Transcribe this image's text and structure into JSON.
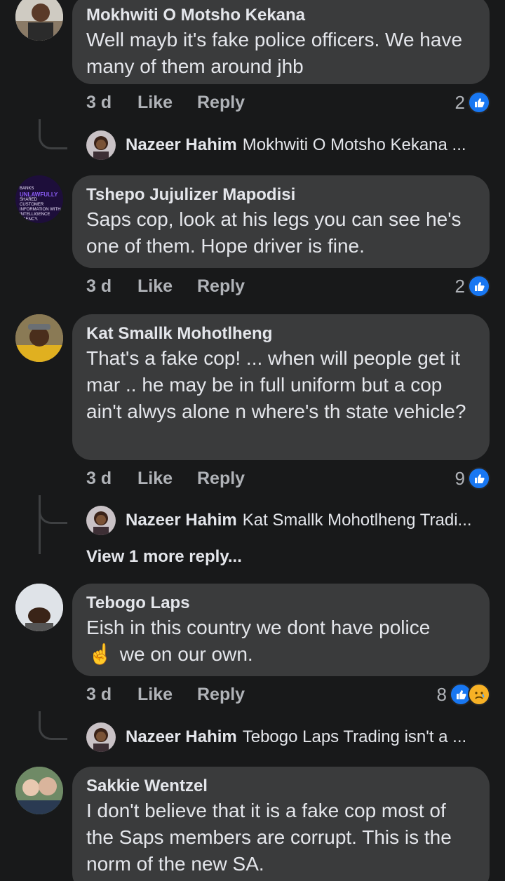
{
  "comments": [
    {
      "author": "Mokhwiti O Motsho Kekana",
      "text": "Well mayb it's fake police officers. We have many of them around jhb",
      "time": "3 d",
      "like_label": "Like",
      "reply_label": "Reply",
      "reaction_count": "2",
      "reply": {
        "author": "Nazeer Hahim",
        "preview": "Mokhwiti O Motsho Kekana ..."
      }
    },
    {
      "author": "Tshepo Jujulizer Mapodisi",
      "text": "Saps cop, look at his legs you can see he's one of them. Hope driver is fine.",
      "time": "3 d",
      "like_label": "Like",
      "reply_label": "Reply",
      "reaction_count": "2",
      "avatar_text": [
        "BANKS",
        "UNLAWFULLY",
        "SHARED CUSTOMER",
        "INFORMATION WITH",
        "INTELLIGENCE",
        "AGENCY."
      ]
    },
    {
      "author": "Kat Smallk Mohotlheng",
      "text": "That's a fake cop! ... when will people get it mar .. he may be in full uniform but a cop ain't alwys alone n where's th state vehicle?",
      "time": "3 d",
      "like_label": "Like",
      "reply_label": "Reply",
      "reaction_count": "9",
      "reply": {
        "author": "Nazeer Hahim",
        "preview": "Kat Smallk Mohotlheng Tradi..."
      },
      "view_more": "View 1 more reply..."
    },
    {
      "author": "Tebogo Laps",
      "text_line1": "Eish in this country we dont have police",
      "emoji": "☝",
      "text_line2": "we on our own.",
      "time": "3 d",
      "like_label": "Like",
      "reply_label": "Reply",
      "reaction_count": "8",
      "reply": {
        "author": "Nazeer Hahim",
        "preview": "Tebogo Laps Trading isn't a ..."
      }
    },
    {
      "author": "Sakkie Wentzel",
      "text": "I don't believe that it is a fake cop most of the Saps members are corrupt. This is the norm of the new SA."
    }
  ],
  "colors": {
    "background": "#18191a",
    "bubble": "#3a3b3c",
    "like_blue": "#1877f2",
    "sad_yellow": "#f7b125",
    "secondary_text": "#b0b3b8"
  },
  "icons": [
    "like-reaction-icon",
    "sad-reaction-icon",
    "pointing-up-emoji"
  ]
}
